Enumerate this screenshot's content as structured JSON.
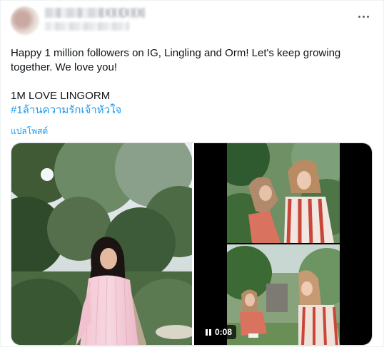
{
  "tweet": {
    "text_line1": "Happy 1 million followers on IG, Lingling and Orm! Let's keep growing",
    "text_line2": "together. We love you!",
    "text_line3": "1M LOVE LINGORM",
    "hashtag": "#1ล้านความรักเจ้าหัวใจ",
    "translate_label": "แปลโพสต์"
  },
  "media": {
    "video_duration": "0:08"
  },
  "icons": {
    "more": "more-options-icon",
    "pause": "pause-icon"
  },
  "colors": {
    "link": "#1d9bf0",
    "text": "#0f1419",
    "icon": "#536471"
  }
}
